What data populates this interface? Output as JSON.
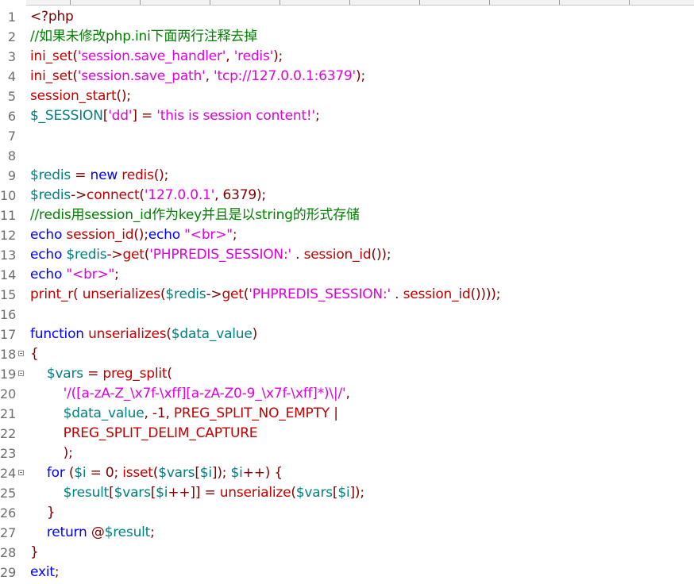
{
  "colors": {
    "default": "#000000",
    "keyword": "#0000ff",
    "function": "#c00000",
    "string": "#e000e0",
    "comment": "#008000",
    "variable": "#008080",
    "punct": "#800000",
    "line_number": "#6e6e6e"
  },
  "lines": [
    {
      "n": "1",
      "fold": false,
      "indent": "",
      "tokens": [
        {
          "t": "<?php",
          "c": "punct"
        }
      ]
    },
    {
      "n": "2",
      "fold": false,
      "indent": "",
      "tokens": [
        {
          "t": "//如果未修改php.ini下面两行注释去掉",
          "c": "comment"
        }
      ]
    },
    {
      "n": "3",
      "fold": false,
      "indent": "",
      "tokens": [
        {
          "t": "ini_set",
          "c": "function"
        },
        {
          "t": "(",
          "c": "punct"
        },
        {
          "t": "'session.save_handler'",
          "c": "string"
        },
        {
          "t": ", ",
          "c": "punct"
        },
        {
          "t": "'redis'",
          "c": "string"
        },
        {
          "t": ");",
          "c": "punct"
        }
      ]
    },
    {
      "n": "4",
      "fold": false,
      "indent": "",
      "tokens": [
        {
          "t": "ini_set",
          "c": "function"
        },
        {
          "t": "(",
          "c": "punct"
        },
        {
          "t": "'session.save_path'",
          "c": "string"
        },
        {
          "t": ", ",
          "c": "punct"
        },
        {
          "t": "'tcp://127.0.0.1:6379'",
          "c": "string"
        },
        {
          "t": ");",
          "c": "punct"
        }
      ]
    },
    {
      "n": "5",
      "fold": false,
      "indent": "",
      "tokens": [
        {
          "t": "session_start",
          "c": "function"
        },
        {
          "t": "();",
          "c": "punct"
        }
      ]
    },
    {
      "n": "6",
      "fold": false,
      "indent": "",
      "tokens": [
        {
          "t": "$_SESSION",
          "c": "variable"
        },
        {
          "t": "[",
          "c": "punct"
        },
        {
          "t": "'dd'",
          "c": "string"
        },
        {
          "t": "] = ",
          "c": "punct"
        },
        {
          "t": "'this is session content!'",
          "c": "string"
        },
        {
          "t": ";",
          "c": "punct"
        }
      ]
    },
    {
      "n": "7",
      "fold": false,
      "indent": "",
      "tokens": []
    },
    {
      "n": "8",
      "fold": false,
      "indent": "",
      "tokens": []
    },
    {
      "n": "9",
      "fold": false,
      "indent": "",
      "tokens": [
        {
          "t": "$redis",
          "c": "variable"
        },
        {
          "t": " = ",
          "c": "punct"
        },
        {
          "t": "new",
          "c": "keyword"
        },
        {
          "t": " ",
          "c": "default"
        },
        {
          "t": "redis",
          "c": "function"
        },
        {
          "t": "();",
          "c": "punct"
        }
      ]
    },
    {
      "n": "10",
      "fold": false,
      "indent": "",
      "tokens": [
        {
          "t": "$redis",
          "c": "variable"
        },
        {
          "t": "->",
          "c": "punct"
        },
        {
          "t": "connect",
          "c": "function"
        },
        {
          "t": "(",
          "c": "punct"
        },
        {
          "t": "'127.0.0.1'",
          "c": "string"
        },
        {
          "t": ", 6379);",
          "c": "punct"
        }
      ]
    },
    {
      "n": "11",
      "fold": false,
      "indent": "",
      "tokens": [
        {
          "t": "//redis用session_id作为key并且是以string的形式存储",
          "c": "comment"
        }
      ]
    },
    {
      "n": "12",
      "fold": false,
      "indent": "",
      "tokens": [
        {
          "t": "echo",
          "c": "keyword"
        },
        {
          "t": " ",
          "c": "default"
        },
        {
          "t": "session_id",
          "c": "function"
        },
        {
          "t": "();",
          "c": "punct"
        },
        {
          "t": "echo",
          "c": "keyword"
        },
        {
          "t": " ",
          "c": "default"
        },
        {
          "t": "\"<br>\"",
          "c": "string"
        },
        {
          "t": ";",
          "c": "punct"
        }
      ]
    },
    {
      "n": "13",
      "fold": false,
      "indent": "",
      "tokens": [
        {
          "t": "echo",
          "c": "keyword"
        },
        {
          "t": " ",
          "c": "default"
        },
        {
          "t": "$redis",
          "c": "variable"
        },
        {
          "t": "->",
          "c": "punct"
        },
        {
          "t": "get",
          "c": "function"
        },
        {
          "t": "(",
          "c": "punct"
        },
        {
          "t": "'PHPREDIS_SESSION:'",
          "c": "string"
        },
        {
          "t": " . ",
          "c": "punct"
        },
        {
          "t": "session_id",
          "c": "function"
        },
        {
          "t": "());",
          "c": "punct"
        }
      ]
    },
    {
      "n": "14",
      "fold": false,
      "indent": "",
      "tokens": [
        {
          "t": "echo",
          "c": "keyword"
        },
        {
          "t": " ",
          "c": "default"
        },
        {
          "t": "\"<br>\"",
          "c": "string"
        },
        {
          "t": ";",
          "c": "punct"
        }
      ]
    },
    {
      "n": "15",
      "fold": false,
      "indent": "",
      "tokens": [
        {
          "t": "print_r",
          "c": "function"
        },
        {
          "t": "( ",
          "c": "punct"
        },
        {
          "t": "unserializes",
          "c": "function"
        },
        {
          "t": "(",
          "c": "punct"
        },
        {
          "t": "$redis",
          "c": "variable"
        },
        {
          "t": "->",
          "c": "punct"
        },
        {
          "t": "get",
          "c": "function"
        },
        {
          "t": "(",
          "c": "punct"
        },
        {
          "t": "'PHPREDIS_SESSION:'",
          "c": "string"
        },
        {
          "t": " . ",
          "c": "punct"
        },
        {
          "t": "session_id",
          "c": "function"
        },
        {
          "t": "())));",
          "c": "punct"
        }
      ]
    },
    {
      "n": "16",
      "fold": false,
      "indent": "",
      "tokens": []
    },
    {
      "n": "17",
      "fold": false,
      "indent": "",
      "tokens": [
        {
          "t": "function",
          "c": "keyword"
        },
        {
          "t": " ",
          "c": "default"
        },
        {
          "t": "unserializes",
          "c": "function"
        },
        {
          "t": "(",
          "c": "punct"
        },
        {
          "t": "$data_value",
          "c": "variable"
        },
        {
          "t": ")",
          "c": "punct"
        }
      ]
    },
    {
      "n": "18",
      "fold": true,
      "indent": "",
      "tokens": [
        {
          "t": "{",
          "c": "punct"
        }
      ]
    },
    {
      "n": "19",
      "fold": true,
      "indent": "    ",
      "tokens": [
        {
          "t": "$vars",
          "c": "variable"
        },
        {
          "t": " = ",
          "c": "punct"
        },
        {
          "t": "preg_split",
          "c": "function"
        },
        {
          "t": "(",
          "c": "punct"
        }
      ]
    },
    {
      "n": "20",
      "fold": false,
      "indent": "        ",
      "tokens": [
        {
          "t": "'/([a-zA-Z_\\x7f-\\xff][a-zA-Z0-9_\\x7f-\\xff]*)\\|/'",
          "c": "string"
        },
        {
          "t": ",",
          "c": "punct"
        }
      ]
    },
    {
      "n": "21",
      "fold": false,
      "indent": "        ",
      "tokens": [
        {
          "t": "$data_value",
          "c": "variable"
        },
        {
          "t": ", -1, ",
          "c": "punct"
        },
        {
          "t": "PREG_SPLIT_NO_EMPTY",
          "c": "function"
        },
        {
          "t": " |",
          "c": "punct"
        }
      ]
    },
    {
      "n": "22",
      "fold": false,
      "indent": "        ",
      "tokens": [
        {
          "t": "PREG_SPLIT_DELIM_CAPTURE",
          "c": "function"
        }
      ]
    },
    {
      "n": "23",
      "fold": false,
      "indent": "        ",
      "tokens": [
        {
          "t": ");",
          "c": "punct"
        }
      ]
    },
    {
      "n": "24",
      "fold": true,
      "indent": "    ",
      "tokens": [
        {
          "t": "for",
          "c": "keyword"
        },
        {
          "t": " (",
          "c": "punct"
        },
        {
          "t": "$i",
          "c": "variable"
        },
        {
          "t": " = 0; ",
          "c": "punct"
        },
        {
          "t": "isset",
          "c": "function"
        },
        {
          "t": "(",
          "c": "punct"
        },
        {
          "t": "$vars",
          "c": "variable"
        },
        {
          "t": "[",
          "c": "punct"
        },
        {
          "t": "$i",
          "c": "variable"
        },
        {
          "t": "]); ",
          "c": "punct"
        },
        {
          "t": "$i",
          "c": "variable"
        },
        {
          "t": "++) {",
          "c": "punct"
        }
      ]
    },
    {
      "n": "25",
      "fold": false,
      "indent": "        ",
      "tokens": [
        {
          "t": "$result",
          "c": "variable"
        },
        {
          "t": "[",
          "c": "punct"
        },
        {
          "t": "$vars",
          "c": "variable"
        },
        {
          "t": "[",
          "c": "punct"
        },
        {
          "t": "$i",
          "c": "variable"
        },
        {
          "t": "++]] = ",
          "c": "punct"
        },
        {
          "t": "unserialize",
          "c": "function"
        },
        {
          "t": "(",
          "c": "punct"
        },
        {
          "t": "$vars",
          "c": "variable"
        },
        {
          "t": "[",
          "c": "punct"
        },
        {
          "t": "$i",
          "c": "variable"
        },
        {
          "t": "]);",
          "c": "punct"
        }
      ]
    },
    {
      "n": "26",
      "fold": false,
      "indent": "    ",
      "tokens": [
        {
          "t": "}",
          "c": "punct"
        }
      ]
    },
    {
      "n": "27",
      "fold": false,
      "indent": "    ",
      "tokens": [
        {
          "t": "return",
          "c": "keyword"
        },
        {
          "t": " @",
          "c": "punct"
        },
        {
          "t": "$result",
          "c": "variable"
        },
        {
          "t": ";",
          "c": "punct"
        }
      ]
    },
    {
      "n": "28",
      "fold": false,
      "indent": "",
      "tokens": [
        {
          "t": "}",
          "c": "punct"
        }
      ]
    },
    {
      "n": "29",
      "fold": false,
      "indent": "",
      "tokens": [
        {
          "t": "exit",
          "c": "keyword"
        },
        {
          "t": ";",
          "c": "punct"
        }
      ]
    }
  ]
}
